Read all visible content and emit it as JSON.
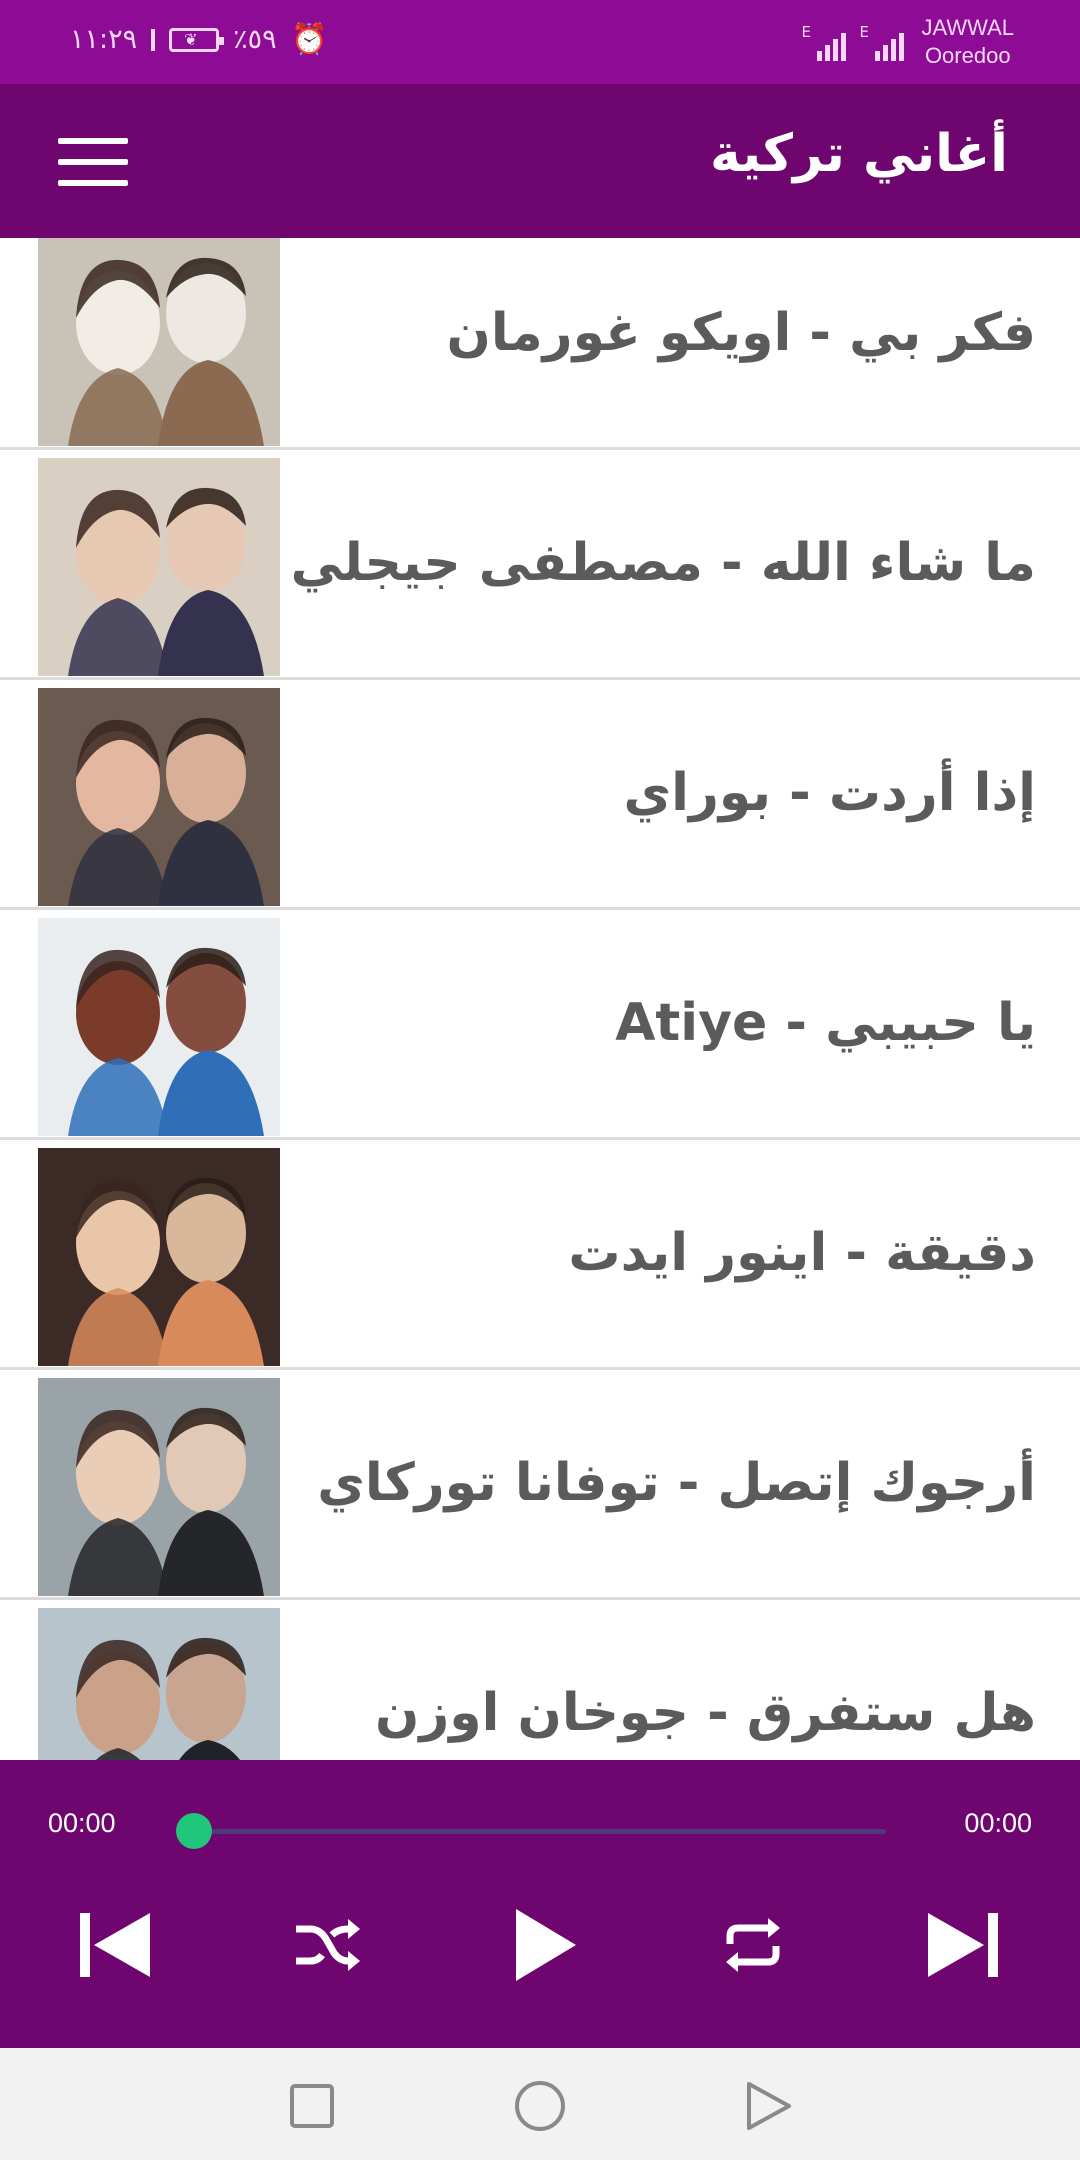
{
  "status_bar": {
    "time": "١١:٢٩",
    "battery_percent": "٪٥٩",
    "carrier_primary": "JAWWAL",
    "carrier_secondary": "Ooredoo",
    "network_type_1": "E",
    "network_type_2": "E",
    "icons": [
      "sim-icon",
      "battery-icon",
      "alarm-icon",
      "signal-icon",
      "signal-icon"
    ]
  },
  "app_bar": {
    "title": "أغاني تركية",
    "menu_icon": "hamburger-menu-icon"
  },
  "songs": [
    {
      "title": "فكر بي - اويكو غورمان",
      "thumb_colors": [
        "#c9c2b7",
        "#8a6b52",
        "#f1ece6"
      ]
    },
    {
      "title": "ما شاء الله - مصطفى جيجلي",
      "thumb_colors": [
        "#d9cfc3",
        "#35324f",
        "#e7c8b3"
      ]
    },
    {
      "title": "إذا أردت - بوراي",
      "thumb_colors": [
        "#6b5a4f",
        "#2f3140",
        "#e4b8a0"
      ]
    },
    {
      "title": "يا حبيبي - Atiye",
      "thumb_colors": [
        "#e9edf0",
        "#2f6fb8",
        "#7a3b2b"
      ]
    },
    {
      "title": "دقيقة - اينور ايدت",
      "thumb_colors": [
        "#3b2a26",
        "#d98a5a",
        "#eac6a8"
      ]
    },
    {
      "title": "أرجوك إتصل - توفانا توركاي",
      "thumb_colors": [
        "#9aa3a8",
        "#252629",
        "#e9cdb7"
      ]
    },
    {
      "title": "هل ستفرق - جوخان اوزن",
      "thumb_colors": [
        "#b7c4cc",
        "#1f2226",
        "#c9a289"
      ]
    }
  ],
  "player": {
    "current_time": "00:00",
    "total_time": "00:00",
    "progress": 0,
    "controls": [
      "skip-previous-icon",
      "shuffle-icon",
      "play-icon",
      "repeat-icon",
      "skip-next-icon"
    ],
    "accent_color": "#20c77a"
  },
  "nav_bar": {
    "icons": [
      "recents-square-icon",
      "home-circle-icon",
      "back-triangle-icon"
    ]
  },
  "colors": {
    "status_bar": "#8e0b96",
    "app_bar": "#6f066f",
    "player": "#6f066f",
    "title_text": "#5b5b5b"
  }
}
